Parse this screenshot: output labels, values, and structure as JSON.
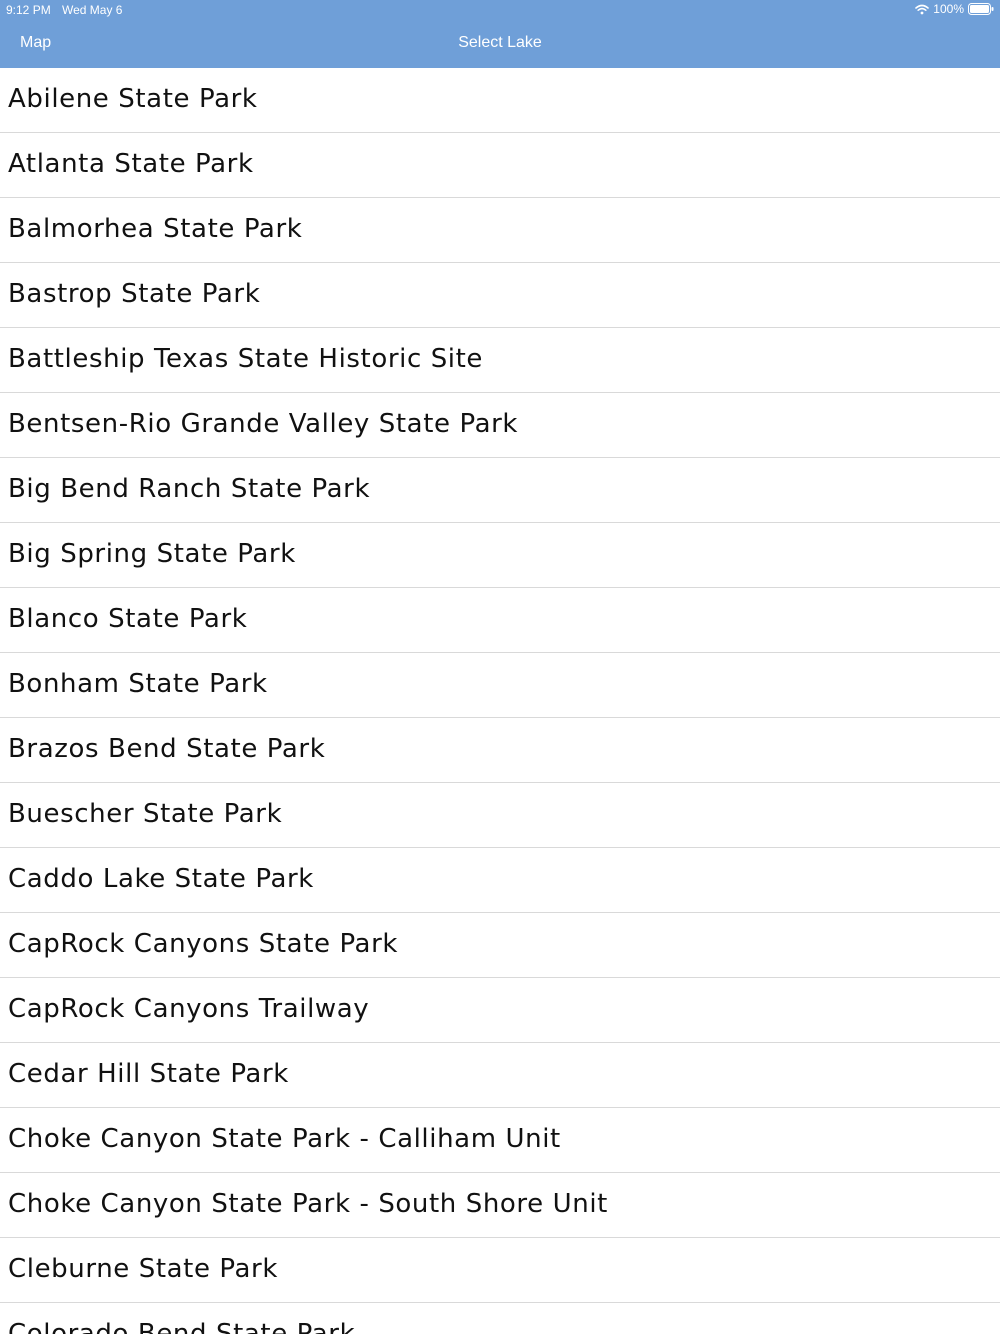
{
  "status_bar": {
    "time": "9:12 PM",
    "date": "Wed May 6",
    "battery_percent": "100%",
    "wifi_icon": "wifi-icon",
    "battery_icon": "battery-icon"
  },
  "nav": {
    "back_label": "Map",
    "title": "Select Lake"
  },
  "colors": {
    "nav_background": "#6f9fd8",
    "nav_text": "#ffffff",
    "separator": "#d9d9d9"
  },
  "parks": [
    "Abilene State Park",
    "Atlanta State Park",
    "Balmorhea State Park",
    "Bastrop State Park",
    "Battleship Texas State Historic Site",
    "Bentsen-Rio Grande Valley State Park",
    "Big Bend Ranch State Park",
    "Big Spring State Park",
    "Blanco State Park",
    "Bonham State Park",
    "Brazos Bend State Park",
    "Buescher State Park",
    "Caddo Lake State Park",
    "CapRock Canyons State Park",
    "CapRock Canyons Trailway",
    "Cedar Hill State Park",
    "Choke Canyon State Park - Calliham Unit",
    "Choke Canyon State Park - South Shore Unit",
    "Cleburne State Park",
    "Colorado Bend State Park"
  ]
}
